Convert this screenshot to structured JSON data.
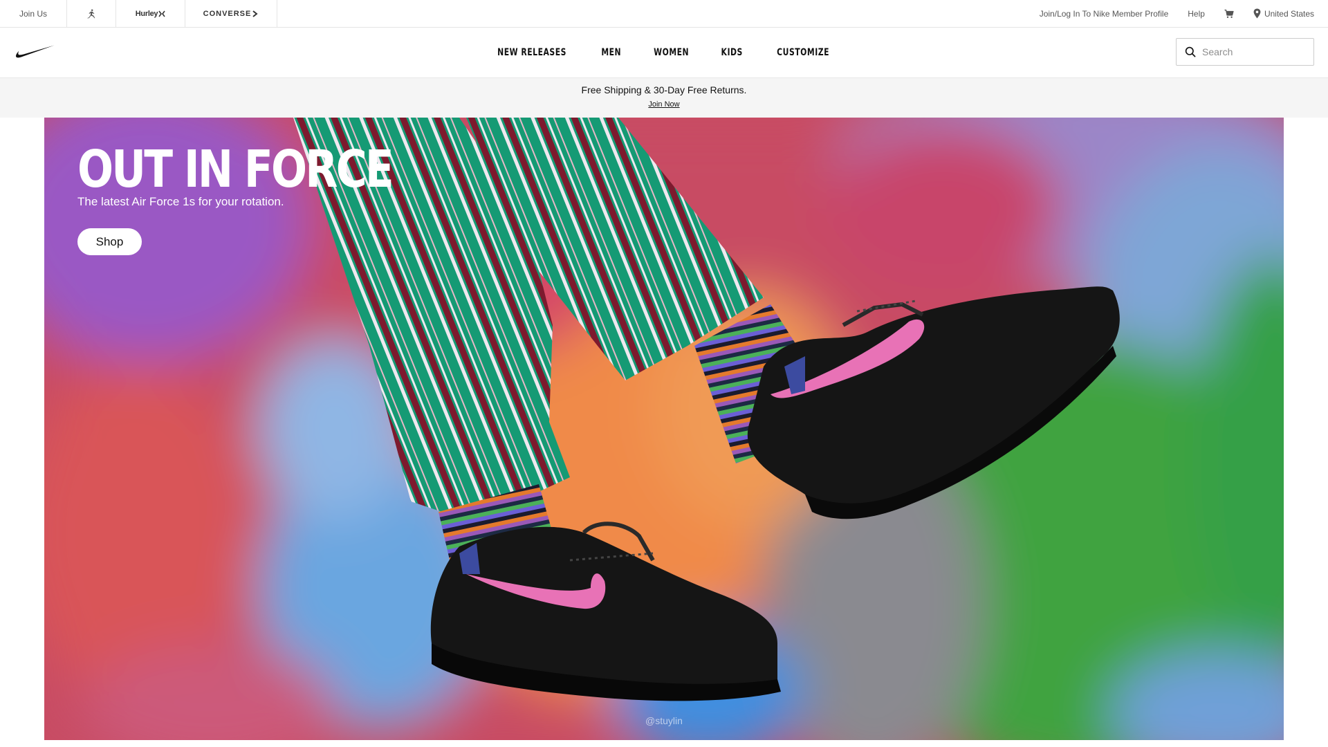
{
  "util_bar": {
    "join_us": "Join Us",
    "brands": [
      "jordan-logo",
      "Hurley",
      "CONVERSE"
    ],
    "hurley_label": "Hurley",
    "converse_label": "CONVERSE",
    "member_profile": "Join/Log In To Nike Member Profile",
    "help": "Help",
    "region": "United States"
  },
  "nav": {
    "logo": "nike-swoosh",
    "links": [
      {
        "label": "NEW RELEASES"
      },
      {
        "label": "MEN"
      },
      {
        "label": "WOMEN"
      },
      {
        "label": "KIDS"
      },
      {
        "label": "CUSTOMIZE"
      }
    ],
    "search_placeholder": "Search"
  },
  "promo": {
    "message": "Free Shipping & 30-Day Free Returns.",
    "link": "Join Now"
  },
  "hero": {
    "title": "OUT IN FORCE",
    "subtitle": "The latest Air Force 1s for your rotation.",
    "cta": "Shop",
    "credit": "@stuylin"
  },
  "colors": {
    "accent_pink": "#e872b6",
    "background_red": "#c84c63",
    "stripe_green": "#159a74",
    "shoe_black": "#111111"
  },
  "icons": [
    "jordan-jumpman-icon",
    "cart-icon",
    "location-pin-icon",
    "search-icon",
    "nike-swoosh-logo"
  ]
}
